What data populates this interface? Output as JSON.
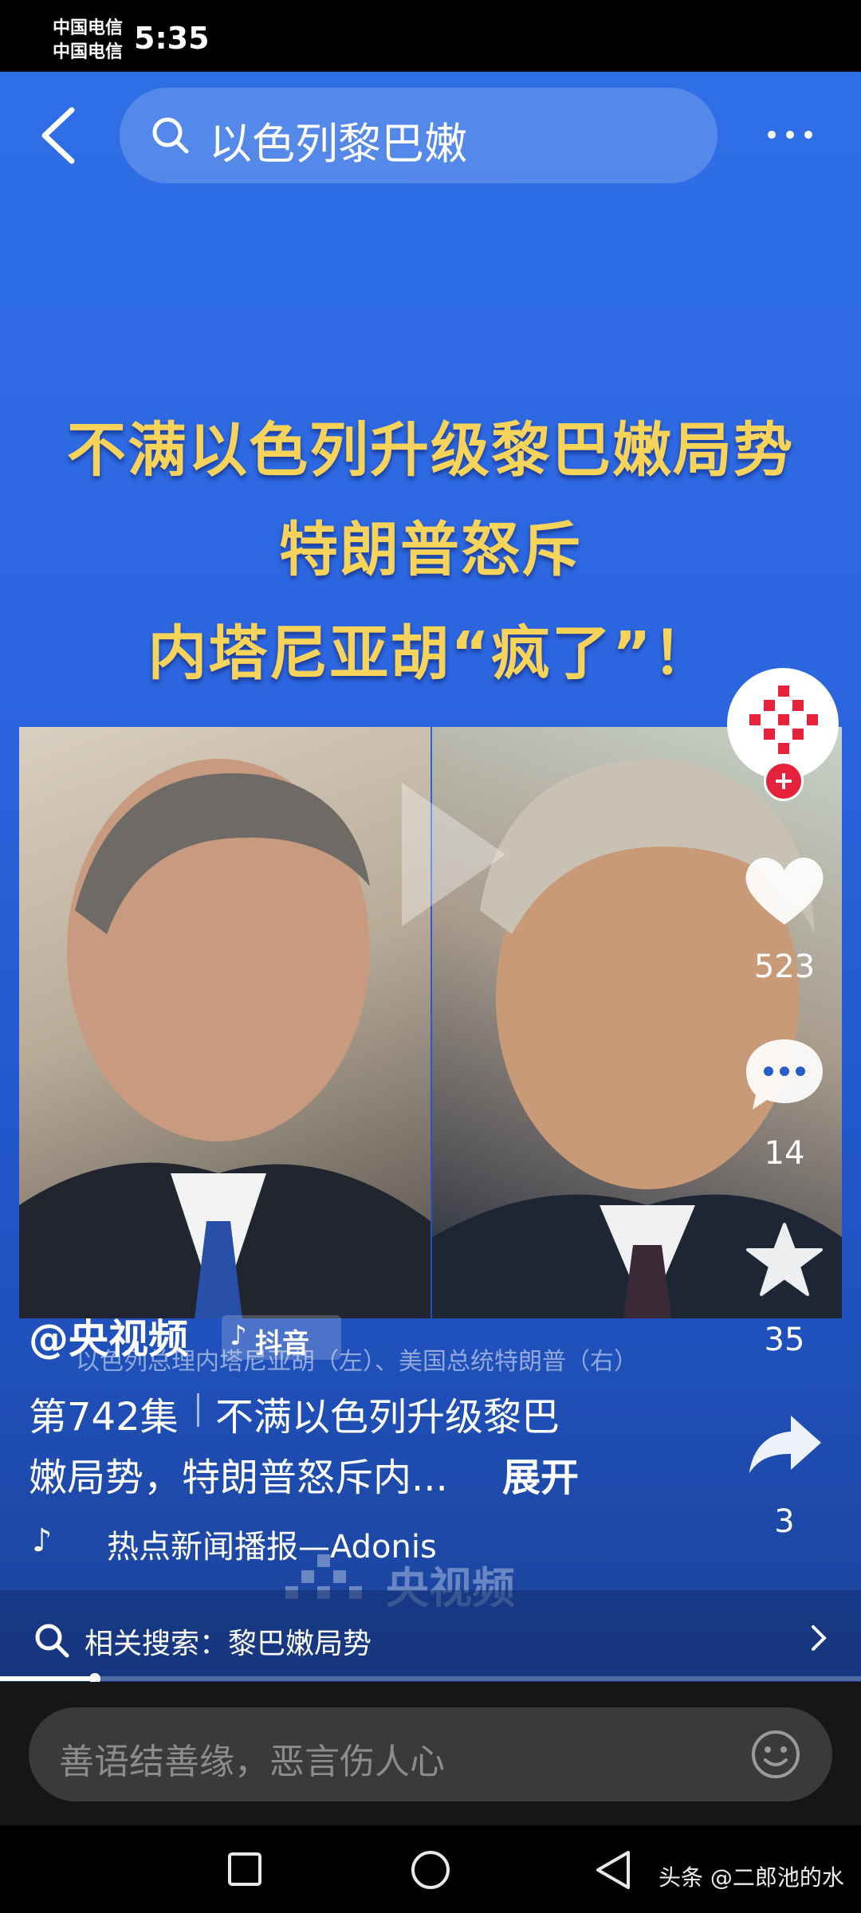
{
  "status_bar": {
    "carrier_1": "中国电信",
    "carrier_2": "中国电信",
    "time": "5:35"
  },
  "top_bar": {
    "search_query": "以色列黎巴嫩"
  },
  "headline": {
    "line_1": "不满以色列升级黎巴嫩局势",
    "line_2": "特朗普怒斥",
    "line_3": "内塔尼亚胡“疯了”！"
  },
  "photo_caption": "以色列总理内塔尼亚胡（左）、美国总统特朗普（右）",
  "actions": {
    "like_count": "523",
    "comment_count": "14",
    "favorite_count": "35",
    "share_count": "3"
  },
  "video_info": {
    "author": "@央视频",
    "platform": "抖音",
    "episode": "第742集",
    "title_line_1": "不满以色列升级黎巴",
    "title_line_2": "嫩局势，特朗普怒斥内...",
    "expand_label": "展开",
    "music": "热点新闻播报—Adonis",
    "watermark": "央视频"
  },
  "related_search": {
    "label": "相关搜索：黎巴嫩局势"
  },
  "progress": 0.11,
  "comment_input": {
    "placeholder": "善语结善缘，恶言伤人心"
  },
  "bottom_watermark": "头条 @二郎池的水",
  "colors": {
    "headline": "#f8d35a",
    "follow_badge": "#e5213b"
  }
}
